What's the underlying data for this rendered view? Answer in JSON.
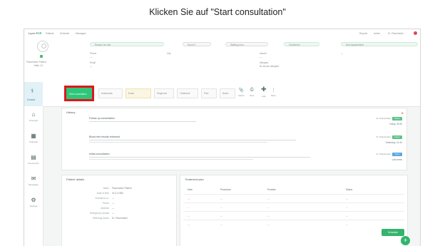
{
  "instruction": "Klicken Sie auf \"Start consultation\"",
  "nav": {
    "logo_a": "Lynx",
    "logo_b": "PCP",
    "items": [
      "Patients",
      "Schedule",
      "Messages"
    ],
    "right": [
      "Reports",
      "Admin",
      "Dr. Placeholder"
    ]
  },
  "patient": {
    "name_line1": "Placeholder Patient",
    "name_line2": "Male, 42",
    "pill_1": "Reason for visit",
    "pill_2": "Room 2",
    "pill_3": "Waiting room",
    "pill_4": "Checked in",
    "pill_5": "Next appointment",
    "field_labels": [
      "Phone",
      "Email",
      "City",
      "Insurer"
    ],
    "field_values": [
      "—",
      "—",
      "—",
      "—"
    ],
    "notes_label": "Allergies",
    "notes_value": "No known allergies"
  },
  "toolbar": {
    "active_tab_label": "Consult",
    "start_label": "Start consultation",
    "steps": [
      "Anamnesis",
      "Exam",
      "Diagnosis",
      "Treatment",
      "Plan",
      "Notes"
    ],
    "icons": [
      {
        "icon": "attach-icon",
        "label": "Attach"
      },
      {
        "icon": "print-icon",
        "label": "Print"
      },
      {
        "icon": "add-icon",
        "label": "Add"
      },
      {
        "icon": "more-icon",
        "label": "More"
      }
    ]
  },
  "sidebar": [
    {
      "label": "Overview",
      "icon": "home-icon"
    },
    {
      "label": "Calendar",
      "icon": "calendar-icon"
    },
    {
      "label": "Documents",
      "icon": "document-icon"
    },
    {
      "label": "Messages",
      "icon": "message-icon"
    },
    {
      "label": "Settings",
      "icon": "gear-icon"
    }
  ],
  "history": {
    "title": "History",
    "entries": [
      {
        "title": "Follow-up consultation",
        "badge": "Done",
        "badge_color": "#5cc38a",
        "when": "Today, 09:30",
        "who": "Dr. Placeholder"
      },
      {
        "title": "Blood test results reviewed",
        "badge": "Done",
        "badge_color": "#5cc38a",
        "when": "Yesterday, 14:10",
        "who": "Dr. Placeholder"
      },
      {
        "title": "Initial consultation",
        "badge": "Open",
        "badge_color": "#58a7de",
        "when": "Last week",
        "who": "Dr. Placeholder"
      }
    ]
  },
  "details": {
    "title": "Patient details",
    "rows": [
      {
        "k": "Name",
        "v": "Placeholder Patient"
      },
      {
        "k": "Date of birth",
        "v": "01.01.1982"
      },
      {
        "k": "Insurance no.",
        "v": "—"
      },
      {
        "k": "Phone",
        "v": "—"
      },
      {
        "k": "Address",
        "v": "—"
      },
      {
        "k": "Emergency contact",
        "v": "—"
      },
      {
        "k": "Referring doctor",
        "v": "Dr. Placeholder"
      }
    ]
  },
  "plan": {
    "title": "Treatment plan",
    "headers": [
      "Date",
      "Procedure",
      "Provider",
      "Status"
    ],
    "rows": [
      [
        "—",
        "—",
        "—",
        "—"
      ],
      [
        "—",
        "—",
        "—",
        "—"
      ],
      [
        "—",
        "—",
        "—",
        "—"
      ],
      [
        "—",
        "—",
        "—",
        "—"
      ]
    ],
    "button_label": "Schedule",
    "fab_label": "+"
  }
}
